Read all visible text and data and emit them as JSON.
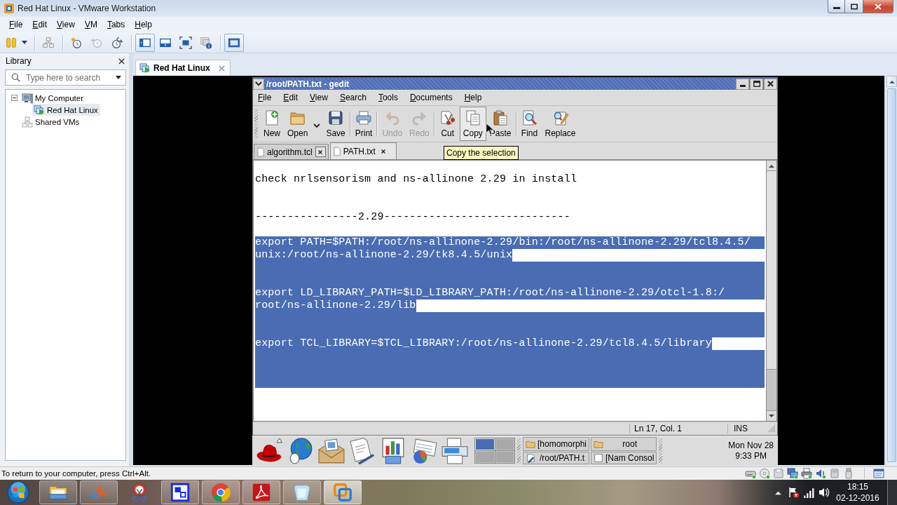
{
  "window": {
    "title": "Red Hat Linux - VMware Workstation"
  },
  "menu": [
    "File",
    "Edit",
    "View",
    "VM",
    "Tabs",
    "Help"
  ],
  "toolbar": [
    {
      "buttons": [
        {
          "kind": "pause",
          "selected": false,
          "disabled": false
        }
      ]
    },
    {
      "buttons": [
        {
          "kind": "send-keys",
          "selected": false,
          "disabled": false
        }
      ]
    },
    {
      "buttons": [
        {
          "kind": "snapshot",
          "selected": false,
          "disabled": false
        },
        {
          "kind": "revert",
          "selected": false,
          "disabled": true
        },
        {
          "kind": "snapshot-manager",
          "selected": false,
          "disabled": false
        }
      ]
    },
    {
      "buttons": [
        {
          "kind": "sidebar-view",
          "selected": true,
          "disabled": false
        },
        {
          "kind": "thumbnail-view",
          "selected": false,
          "disabled": false
        },
        {
          "kind": "full-screen",
          "selected": false,
          "disabled": false
        },
        {
          "kind": "unity",
          "selected": false,
          "disabled": false
        }
      ]
    },
    {
      "buttons": [
        {
          "kind": "console-view",
          "selected": true,
          "disabled": false
        }
      ]
    }
  ],
  "library": {
    "title": "Library",
    "search": {
      "placeholder": "Type here to search"
    },
    "tree": [
      {
        "label": "My Computer",
        "kind": "computer",
        "selected": false,
        "expanded": true,
        "children": [
          {
            "label": "Red Hat Linux",
            "kind": "vm",
            "selected": true
          }
        ]
      },
      {
        "label": "Shared VMs",
        "kind": "shared",
        "selected": false
      }
    ]
  },
  "vm_tabs": [
    {
      "label": "Red Hat Linux",
      "selected": true
    }
  ],
  "guest": {
    "gedit": {
      "title": "/root/PATH.txt - gedit",
      "menu": [
        "File",
        "Edit",
        "View",
        "Search",
        "Tools",
        "Documents",
        "Help"
      ],
      "toolbar": [
        {
          "buttons": [
            {
              "label": "New",
              "kind": "new",
              "disabled": false,
              "highlighted": false
            },
            {
              "label": "Open",
              "kind": "open",
              "disabled": false,
              "highlighted": false
            },
            {
              "label": "Save",
              "kind": "save",
              "disabled": false,
              "highlighted": false
            }
          ]
        },
        {
          "buttons": [
            {
              "label": "Print",
              "kind": "print",
              "disabled": false,
              "highlighted": false
            }
          ]
        },
        {
          "buttons": [
            {
              "label": "Undo",
              "kind": "undo",
              "disabled": true,
              "highlighted": false
            },
            {
              "label": "Redo",
              "kind": "redo",
              "disabled": true,
              "highlighted": false
            }
          ]
        },
        {
          "buttons": [
            {
              "label": "Cut",
              "kind": "cut",
              "disabled": false,
              "highlighted": false
            },
            {
              "label": "Copy",
              "kind": "copy",
              "disabled": false,
              "highlighted": true
            },
            {
              "label": "Paste",
              "kind": "paste",
              "disabled": false,
              "highlighted": false
            }
          ]
        },
        {
          "buttons": [
            {
              "label": "Find",
              "kind": "find",
              "disabled": false,
              "highlighted": false
            },
            {
              "label": "Replace",
              "kind": "replace",
              "disabled": false,
              "highlighted": false
            }
          ]
        }
      ],
      "tabs": [
        {
          "label": "algorithm.tcl",
          "selected": false
        },
        {
          "label": "PATH.txt",
          "selected": true
        }
      ],
      "tooltip": "Copy the selection",
      "lines": [
        {
          "kind": "blank",
          "selected": false
        },
        {
          "kind": "line",
          "text": "check nrlsensorism and ns-allinone 2.29 in install",
          "selected": false
        },
        {
          "kind": "blank",
          "selected": false
        },
        {
          "kind": "blank",
          "selected": false
        },
        {
          "kind": "line",
          "text": "----------------2.29-----------------------------",
          "selected": false
        },
        {
          "kind": "blank",
          "selected": false
        },
        {
          "kind": "wrap",
          "text": "export PATH=$PATH:/root/ns-allinone-2.29/bin:/root/ns-allinone-2.29/tcl8.4.5/",
          "selected": true
        },
        {
          "kind": "line",
          "text": "unix:/root/ns-allinone-2.29/tk8.4.5/unix",
          "selected": true
        },
        {
          "kind": "blank",
          "selected": true
        },
        {
          "kind": "blank",
          "selected": true
        },
        {
          "kind": "wrap",
          "text": "export LD_LIBRARY_PATH=$LD_LIBRARY_PATH:/root/ns-allinone-2.29/otcl-1.8:/",
          "selected": true
        },
        {
          "kind": "line",
          "text": "root/ns-allinone-2.29/lib",
          "selected": true
        },
        {
          "kind": "blank",
          "selected": true
        },
        {
          "kind": "blank",
          "selected": true
        },
        {
          "kind": "line",
          "text": "export TCL_LIBRARY=$TCL_LIBRARY:/root/ns-allinone-2.29/tcl8.4.5/library",
          "selected": true
        },
        {
          "kind": "blank",
          "selected": true
        },
        {
          "kind": "blank",
          "selected": true
        },
        {
          "kind": "blank",
          "selected": true
        }
      ],
      "status": {
        "position": "Ln 17, Col. 1",
        "mode": "INS"
      }
    },
    "panel": {
      "workspaces": [
        {
          "selected": true
        },
        {
          "selected": false
        },
        {
          "selected": false
        },
        {
          "selected": false
        }
      ],
      "windows": [
        {
          "label": "[homomorphi",
          "kind": "folder"
        },
        {
          "label": "root",
          "kind": "folder"
        },
        {
          "label": "/root/PATH.t",
          "kind": "editor"
        },
        {
          "label": "[Nam Consol",
          "kind": "window"
        }
      ],
      "clock": {
        "date": "Mon Nov 28",
        "time": "9:33 PM"
      }
    }
  },
  "status_bar": {
    "message": "To return to your computer, press Ctrl+Alt.",
    "devices": [
      {
        "kind": "hard-disk",
        "connected": true
      },
      {
        "kind": "cd",
        "connected": true
      },
      {
        "kind": "floppy",
        "connected": false
      },
      {
        "kind": "network",
        "connected": true
      },
      {
        "kind": "printer",
        "connected": true
      },
      {
        "kind": "sound",
        "connected": true
      },
      {
        "kind": "usb",
        "connected": false
      },
      {
        "kind": "usb-drive",
        "connected": false
      },
      {
        "kind": "message",
        "connected": false
      }
    ]
  },
  "taskbar": {
    "apps": [
      {
        "kind": "folder",
        "running": true,
        "selected": false
      },
      {
        "kind": "peak",
        "running": true,
        "selected": false
      },
      {
        "kind": "scissors",
        "running": false,
        "selected": false
      },
      {
        "kind": "square",
        "running": true,
        "selected": false
      },
      {
        "kind": "circle-logo",
        "running": true,
        "selected": false
      },
      {
        "kind": "pdf",
        "running": true,
        "selected": false
      },
      {
        "kind": "notepad",
        "running": true,
        "selected": false
      },
      {
        "kind": "squares",
        "running": true,
        "selected": true
      }
    ],
    "clock": {
      "time": "18:15",
      "date": "02-12-2016"
    }
  }
}
